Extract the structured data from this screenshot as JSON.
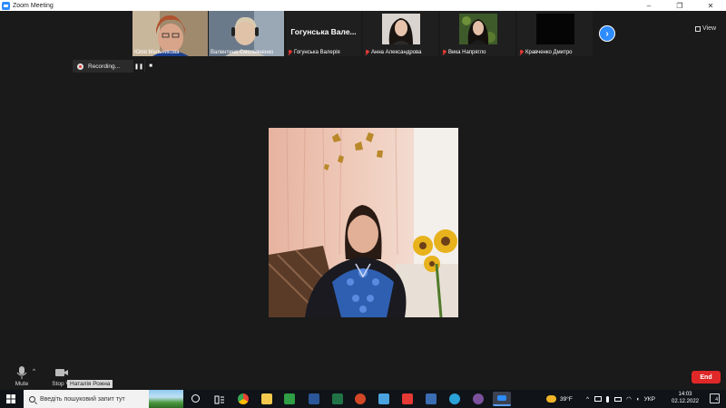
{
  "window": {
    "title": "Zoom Meeting",
    "minimize": "–",
    "restore": "❐",
    "close": "✕"
  },
  "participants": [
    {
      "name": "Юлія Мельникова",
      "muted": false
    },
    {
      "name": "Валентина Ємельяненко",
      "muted": false
    },
    {
      "name": "Гогунська Валерія",
      "muted": true,
      "display_name": "Гогунська  Вале..."
    },
    {
      "name": "Анна Александрова",
      "muted": true
    },
    {
      "name": "Вика Напрягло",
      "muted": true
    },
    {
      "name": "Кравченко Дмитро",
      "muted": true
    }
  ],
  "strip": {
    "next_icon": "chevron-right-icon",
    "next_glyph": "›",
    "view_label": "View"
  },
  "recording": {
    "label": "Recording...",
    "pause_glyph": "❚❚",
    "stop_glyph": "■"
  },
  "controls": {
    "mute_label": "Mute",
    "stop_video_label": "Stop V",
    "end_label": "End",
    "hover_name": "Наталія Рожна"
  },
  "taskbar": {
    "search_placeholder": "Введіть пошуковий запит тут",
    "weather": "39°F",
    "language": "УКР",
    "time": "14:03",
    "date": "02.12.2022",
    "notifications": "4"
  },
  "colors": {
    "accent": "#2d8cff",
    "end": "#e02828",
    "background": "#1a1a1a"
  }
}
